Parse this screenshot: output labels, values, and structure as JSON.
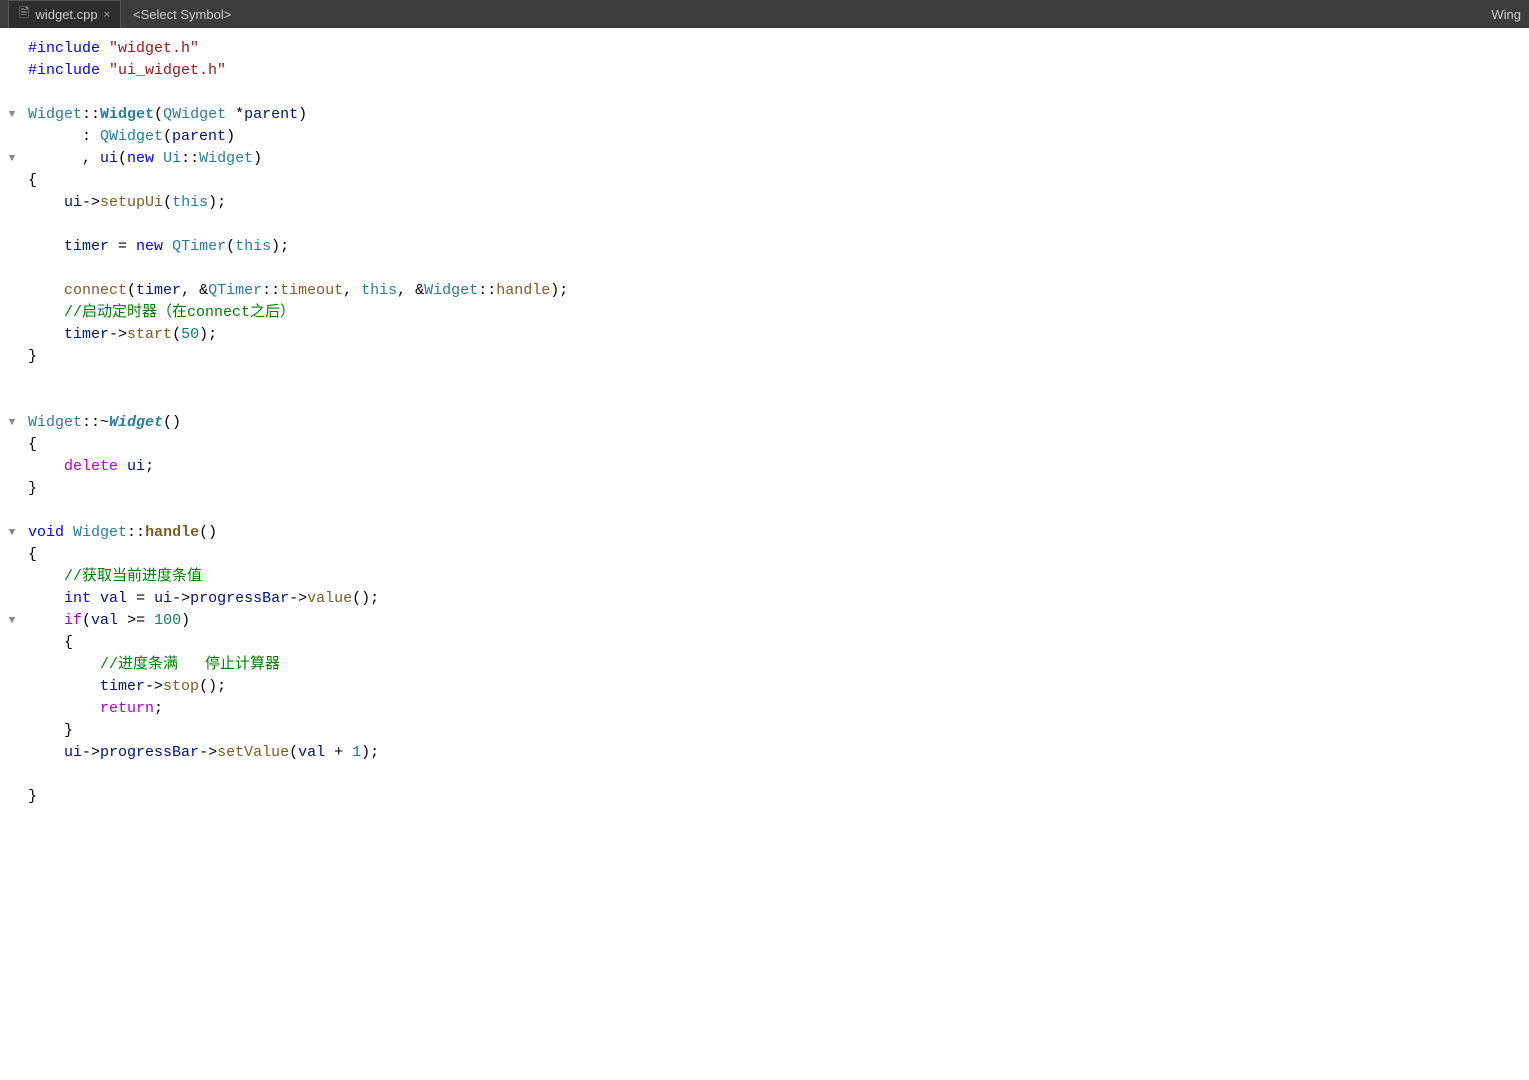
{
  "titleBar": {
    "tab1": {
      "icon": "📄",
      "label": "widget.cpp",
      "close": "×"
    },
    "tab2": {
      "label": "<Select Symbol>"
    },
    "windowLabel": "Wing"
  },
  "code": {
    "lines": [
      {
        "fold": "",
        "bar": false,
        "tokens": [
          {
            "type": "kw-include",
            "text": "#include"
          },
          {
            "type": "plain",
            "text": " "
          },
          {
            "type": "kw-string",
            "text": "\"widget.h\""
          }
        ]
      },
      {
        "fold": "",
        "bar": false,
        "tokens": [
          {
            "type": "kw-include",
            "text": "#include"
          },
          {
            "type": "plain",
            "text": " "
          },
          {
            "type": "kw-string",
            "text": "\"ui_widget.h\""
          }
        ]
      },
      {
        "fold": "",
        "bar": false,
        "tokens": []
      },
      {
        "fold": "▼",
        "bar": false,
        "tokens": [
          {
            "type": "kw-class",
            "text": "Widget"
          },
          {
            "type": "plain",
            "text": "::"
          },
          {
            "type": "kw-bold kw-class",
            "text": "Widget"
          },
          {
            "type": "plain",
            "text": "("
          },
          {
            "type": "kw-class",
            "text": "QWidget"
          },
          {
            "type": "plain",
            "text": " *"
          },
          {
            "type": "kw-param",
            "text": "parent"
          },
          {
            "type": "plain",
            "text": ")"
          }
        ]
      },
      {
        "fold": "",
        "bar": false,
        "tokens": [
          {
            "type": "plain",
            "text": "      : "
          },
          {
            "type": "kw-class",
            "text": "QWidget"
          },
          {
            "type": "plain",
            "text": "("
          },
          {
            "type": "kw-param",
            "text": "parent"
          },
          {
            "type": "plain",
            "text": ")"
          }
        ]
      },
      {
        "fold": "▼",
        "bar": false,
        "tokens": [
          {
            "type": "plain",
            "text": "      , "
          },
          {
            "type": "kw-param",
            "text": "ui"
          },
          {
            "type": "plain",
            "text": "("
          },
          {
            "type": "kw-new",
            "text": "new"
          },
          {
            "type": "plain",
            "text": " "
          },
          {
            "type": "kw-class",
            "text": "Ui"
          },
          {
            "type": "plain",
            "text": "::"
          },
          {
            "type": "kw-class",
            "text": "Widget"
          },
          {
            "type": "plain",
            "text": ")"
          }
        ]
      },
      {
        "fold": "",
        "bar": false,
        "tokens": [
          {
            "type": "plain",
            "text": "{"
          }
        ]
      },
      {
        "fold": "",
        "bar": true,
        "tokens": [
          {
            "type": "plain",
            "text": "    "
          },
          {
            "type": "kw-param",
            "text": "ui"
          },
          {
            "type": "plain",
            "text": "->"
          },
          {
            "type": "kw-func",
            "text": "setupUi"
          },
          {
            "type": "plain",
            "text": "("
          },
          {
            "type": "kw-this",
            "text": "this"
          },
          {
            "type": "plain",
            "text": ");"
          }
        ]
      },
      {
        "fold": "",
        "bar": true,
        "tokens": []
      },
      {
        "fold": "",
        "bar": true,
        "tokens": [
          {
            "type": "plain",
            "text": "    "
          },
          {
            "type": "kw-param",
            "text": "timer"
          },
          {
            "type": "plain",
            "text": " = "
          },
          {
            "type": "kw-new",
            "text": "new"
          },
          {
            "type": "plain",
            "text": " "
          },
          {
            "type": "kw-class",
            "text": "QTimer"
          },
          {
            "type": "plain",
            "text": "("
          },
          {
            "type": "kw-this",
            "text": "this"
          },
          {
            "type": "plain",
            "text": ");"
          }
        ]
      },
      {
        "fold": "",
        "bar": true,
        "tokens": []
      },
      {
        "fold": "",
        "bar": true,
        "tokens": [
          {
            "type": "plain",
            "text": "    "
          },
          {
            "type": "kw-func",
            "text": "connect"
          },
          {
            "type": "plain",
            "text": "("
          },
          {
            "type": "kw-param",
            "text": "timer"
          },
          {
            "type": "plain",
            "text": ", &"
          },
          {
            "type": "kw-class",
            "text": "QTimer"
          },
          {
            "type": "plain",
            "text": "::"
          },
          {
            "type": "kw-func",
            "text": "timeout"
          },
          {
            "type": "plain",
            "text": ", "
          },
          {
            "type": "kw-this",
            "text": "this"
          },
          {
            "type": "plain",
            "text": ", &"
          },
          {
            "type": "kw-class",
            "text": "Widget"
          },
          {
            "type": "plain",
            "text": "::"
          },
          {
            "type": "kw-func",
            "text": "handle"
          },
          {
            "type": "plain",
            "text": ");"
          }
        ]
      },
      {
        "fold": "",
        "bar": true,
        "tokens": [
          {
            "type": "kw-comment",
            "text": "    //启动定时器（在connect之后）"
          }
        ]
      },
      {
        "fold": "",
        "bar": true,
        "tokens": [
          {
            "type": "plain",
            "text": "    "
          },
          {
            "type": "kw-param",
            "text": "timer"
          },
          {
            "type": "plain",
            "text": "->"
          },
          {
            "type": "kw-func",
            "text": "start"
          },
          {
            "type": "plain",
            "text": "("
          },
          {
            "type": "kw-number",
            "text": "50"
          },
          {
            "type": "plain",
            "text": ");"
          }
        ]
      },
      {
        "fold": "",
        "bar": false,
        "tokens": [
          {
            "type": "plain",
            "text": "}"
          }
        ]
      },
      {
        "fold": "",
        "bar": false,
        "tokens": []
      },
      {
        "fold": "",
        "bar": false,
        "tokens": []
      },
      {
        "fold": "▼",
        "bar": false,
        "tokens": [
          {
            "type": "kw-class",
            "text": "Widget"
          },
          {
            "type": "plain",
            "text": "::~"
          },
          {
            "type": "kw-destructor",
            "text": "Widget"
          },
          {
            "type": "plain",
            "text": "()"
          }
        ]
      },
      {
        "fold": "",
        "bar": false,
        "tokens": [
          {
            "type": "plain",
            "text": "{"
          }
        ]
      },
      {
        "fold": "",
        "bar": true,
        "tokens": [
          {
            "type": "plain",
            "text": "    "
          },
          {
            "type": "kw-delete",
            "text": "delete"
          },
          {
            "type": "plain",
            "text": " "
          },
          {
            "type": "kw-param",
            "text": "ui"
          },
          {
            "type": "plain",
            "text": ";"
          }
        ]
      },
      {
        "fold": "",
        "bar": false,
        "tokens": [
          {
            "type": "plain",
            "text": "}"
          }
        ]
      },
      {
        "fold": "",
        "bar": false,
        "tokens": []
      },
      {
        "fold": "▼",
        "bar": false,
        "tokens": [
          {
            "type": "kw-void",
            "text": "void"
          },
          {
            "type": "plain",
            "text": " "
          },
          {
            "type": "kw-class",
            "text": "Widget"
          },
          {
            "type": "plain",
            "text": "::"
          },
          {
            "type": "kw-bold kw-func",
            "text": "handle"
          },
          {
            "type": "plain",
            "text": "()"
          }
        ]
      },
      {
        "fold": "",
        "bar": false,
        "tokens": [
          {
            "type": "plain",
            "text": "{"
          }
        ]
      },
      {
        "fold": "",
        "bar": true,
        "tokens": [
          {
            "type": "kw-comment",
            "text": "    //获取当前进度条值"
          }
        ]
      },
      {
        "fold": "",
        "bar": true,
        "tokens": [
          {
            "type": "plain",
            "text": "    "
          },
          {
            "type": "kw-int",
            "text": "int"
          },
          {
            "type": "plain",
            "text": " "
          },
          {
            "type": "kw-param",
            "text": "val"
          },
          {
            "type": "plain",
            "text": " = "
          },
          {
            "type": "kw-param",
            "text": "ui"
          },
          {
            "type": "plain",
            "text": "->"
          },
          {
            "type": "kw-param",
            "text": "progressBar"
          },
          {
            "type": "plain",
            "text": "->"
          },
          {
            "type": "kw-func",
            "text": "value"
          },
          {
            "type": "plain",
            "text": "();"
          }
        ]
      },
      {
        "fold": "▼",
        "bar": true,
        "tokens": [
          {
            "type": "plain",
            "text": "    "
          },
          {
            "type": "kw-if",
            "text": "if"
          },
          {
            "type": "plain",
            "text": "("
          },
          {
            "type": "kw-param",
            "text": "val"
          },
          {
            "type": "plain",
            "text": " >= "
          },
          {
            "type": "kw-number",
            "text": "100"
          },
          {
            "type": "plain",
            "text": ")"
          }
        ]
      },
      {
        "fold": "",
        "bar": true,
        "tokens": [
          {
            "type": "plain",
            "text": "    {"
          }
        ]
      },
      {
        "fold": "",
        "bar": true,
        "tokens": [
          {
            "type": "kw-comment",
            "text": "        //进度条满   停止计算器"
          }
        ]
      },
      {
        "fold": "",
        "bar": true,
        "tokens": [
          {
            "type": "plain",
            "text": "        "
          },
          {
            "type": "kw-param",
            "text": "timer"
          },
          {
            "type": "plain",
            "text": "->"
          },
          {
            "type": "kw-func",
            "text": "stop"
          },
          {
            "type": "plain",
            "text": "();"
          }
        ]
      },
      {
        "fold": "",
        "bar": true,
        "tokens": [
          {
            "type": "plain",
            "text": "        "
          },
          {
            "type": "kw-return",
            "text": "return"
          },
          {
            "type": "plain",
            "text": ";"
          }
        ]
      },
      {
        "fold": "",
        "bar": true,
        "tokens": [
          {
            "type": "plain",
            "text": "    }"
          }
        ]
      },
      {
        "fold": "",
        "bar": true,
        "tokens": [
          {
            "type": "plain",
            "text": "    "
          },
          {
            "type": "kw-param",
            "text": "ui"
          },
          {
            "type": "plain",
            "text": "->"
          },
          {
            "type": "kw-param",
            "text": "progressBar"
          },
          {
            "type": "plain",
            "text": "->"
          },
          {
            "type": "kw-func",
            "text": "setValue"
          },
          {
            "type": "plain",
            "text": "("
          },
          {
            "type": "kw-param",
            "text": "val"
          },
          {
            "type": "plain",
            "text": " + "
          },
          {
            "type": "kw-number",
            "text": "1"
          },
          {
            "type": "plain",
            "text": ");"
          }
        ]
      },
      {
        "fold": "",
        "bar": true,
        "tokens": []
      },
      {
        "fold": "",
        "bar": false,
        "tokens": [
          {
            "type": "plain",
            "text": "}"
          }
        ]
      }
    ]
  }
}
